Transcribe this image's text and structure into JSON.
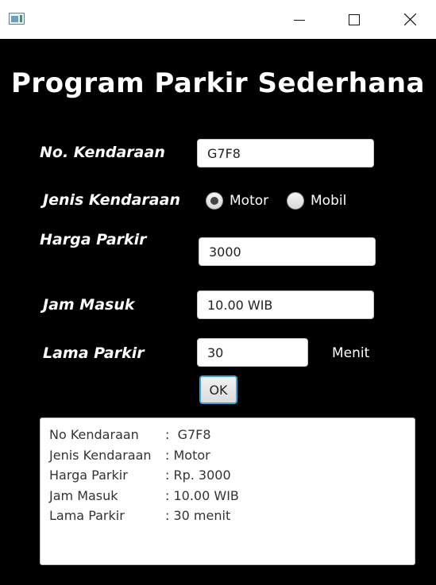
{
  "window": {
    "controls": [
      "minimize",
      "maximize",
      "close"
    ]
  },
  "heading": "Program Parkir Sederhana",
  "form": {
    "no_kendaraan": {
      "label": "No. Kendaraan",
      "value": "G7F8"
    },
    "jenis_kendaraan": {
      "label": "Jenis Kendaraan",
      "options": [
        {
          "label": "Motor",
          "checked": true
        },
        {
          "label": "Mobil",
          "checked": false
        }
      ]
    },
    "harga_parkir": {
      "label": "Harga Parkir",
      "value": "3000"
    },
    "jam_masuk": {
      "label": "Jam Masuk",
      "value": "10.00 WIB"
    },
    "lama_parkir": {
      "label": "Lama Parkir",
      "value": "30",
      "unit": "Menit"
    },
    "ok_label": "OK"
  },
  "output": {
    "rows": [
      {
        "key": "No Kendaraan",
        "value": ":  G7F8"
      },
      {
        "key": "Jenis Kendaraan",
        "value": ": Motor"
      },
      {
        "key": "Harga Parkir",
        "value": ": Rp. 3000"
      },
      {
        "key": "Jam Masuk",
        "value": ": 10.00 WIB"
      },
      {
        "key": "Lama Parkir",
        "value": ": 30 menit"
      }
    ]
  }
}
